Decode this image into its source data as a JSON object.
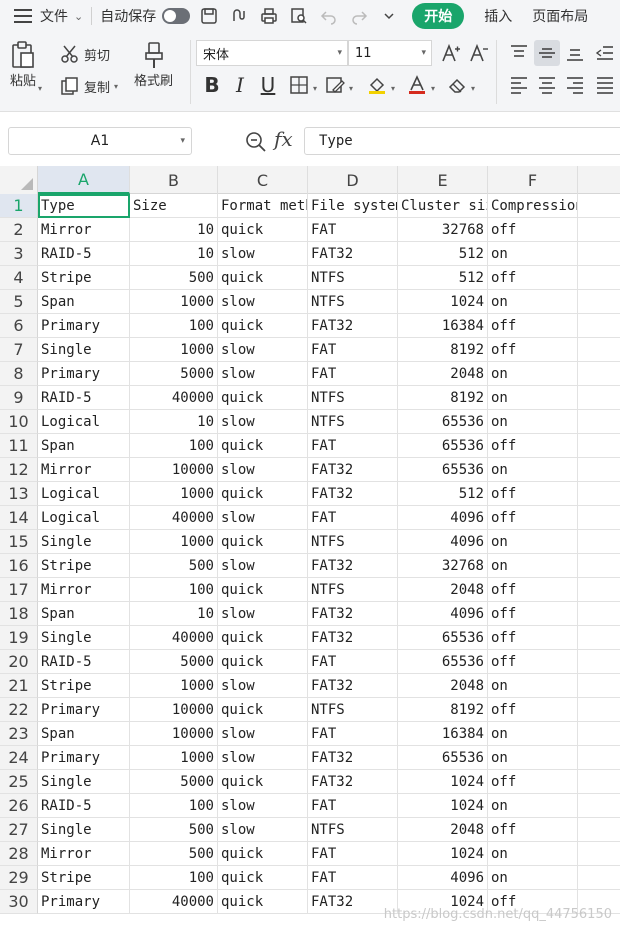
{
  "menu": {
    "file_label": "文件",
    "autosave_label": "自动保存",
    "start_label": "开始",
    "insert_label": "插入",
    "page_layout_label": "页面布局"
  },
  "ribbon": {
    "paste_label": "粘贴",
    "cut_label": "剪切",
    "copy_label": "复制",
    "format_painter_label": "格式刷",
    "font_name": "宋体",
    "font_size": "11",
    "bold": "B",
    "italic": "I",
    "underline": "U"
  },
  "formula_bar": {
    "name_box": "A1",
    "fx": "fx",
    "content": "Type"
  },
  "columns": [
    "A",
    "B",
    "C",
    "D",
    "E",
    "F"
  ],
  "header": [
    "Type",
    "Size",
    "Format method",
    "File system",
    "Cluster size",
    "Compression"
  ],
  "rows": [
    [
      "Mirror",
      "10",
      "quick",
      "FAT",
      "32768",
      "off"
    ],
    [
      "RAID-5",
      "10",
      "slow",
      "FAT32",
      "512",
      "on"
    ],
    [
      "Stripe",
      "500",
      "quick",
      "NTFS",
      "512",
      "off"
    ],
    [
      "Span",
      "1000",
      "slow",
      "NTFS",
      "1024",
      "on"
    ],
    [
      "Primary",
      "100",
      "quick",
      "FAT32",
      "16384",
      "off"
    ],
    [
      "Single",
      "1000",
      "slow",
      "FAT",
      "8192",
      "off"
    ],
    [
      "Primary",
      "5000",
      "slow",
      "FAT",
      "2048",
      "on"
    ],
    [
      "RAID-5",
      "40000",
      "quick",
      "NTFS",
      "8192",
      "on"
    ],
    [
      "Logical",
      "10",
      "slow",
      "NTFS",
      "65536",
      "on"
    ],
    [
      "Span",
      "100",
      "quick",
      "FAT",
      "65536",
      "off"
    ],
    [
      "Mirror",
      "10000",
      "slow",
      "FAT32",
      "65536",
      "on"
    ],
    [
      "Logical",
      "1000",
      "quick",
      "FAT32",
      "512",
      "off"
    ],
    [
      "Logical",
      "40000",
      "slow",
      "FAT",
      "4096",
      "off"
    ],
    [
      "Single",
      "1000",
      "quick",
      "NTFS",
      "4096",
      "on"
    ],
    [
      "Stripe",
      "500",
      "slow",
      "FAT32",
      "32768",
      "on"
    ],
    [
      "Mirror",
      "100",
      "quick",
      "NTFS",
      "2048",
      "off"
    ],
    [
      "Span",
      "10",
      "slow",
      "FAT32",
      "4096",
      "off"
    ],
    [
      "Single",
      "40000",
      "quick",
      "FAT32",
      "65536",
      "off"
    ],
    [
      "RAID-5",
      "5000",
      "quick",
      "FAT",
      "65536",
      "off"
    ],
    [
      "Stripe",
      "1000",
      "slow",
      "FAT32",
      "2048",
      "on"
    ],
    [
      "Primary",
      "10000",
      "quick",
      "NTFS",
      "8192",
      "off"
    ],
    [
      "Span",
      "10000",
      "slow",
      "FAT",
      "16384",
      "on"
    ],
    [
      "Primary",
      "1000",
      "slow",
      "FAT32",
      "65536",
      "on"
    ],
    [
      "Single",
      "5000",
      "quick",
      "FAT32",
      "1024",
      "off"
    ],
    [
      "RAID-5",
      "100",
      "slow",
      "FAT",
      "1024",
      "on"
    ],
    [
      "Single",
      "500",
      "slow",
      "NTFS",
      "2048",
      "off"
    ],
    [
      "Mirror",
      "500",
      "quick",
      "FAT",
      "1024",
      "on"
    ],
    [
      "Stripe",
      "100",
      "quick",
      "FAT",
      "4096",
      "on"
    ],
    [
      "Primary",
      "40000",
      "quick",
      "FAT32",
      "1024",
      "off"
    ]
  ],
  "watermark": "https://blog.csdn.net/qq_44756150"
}
